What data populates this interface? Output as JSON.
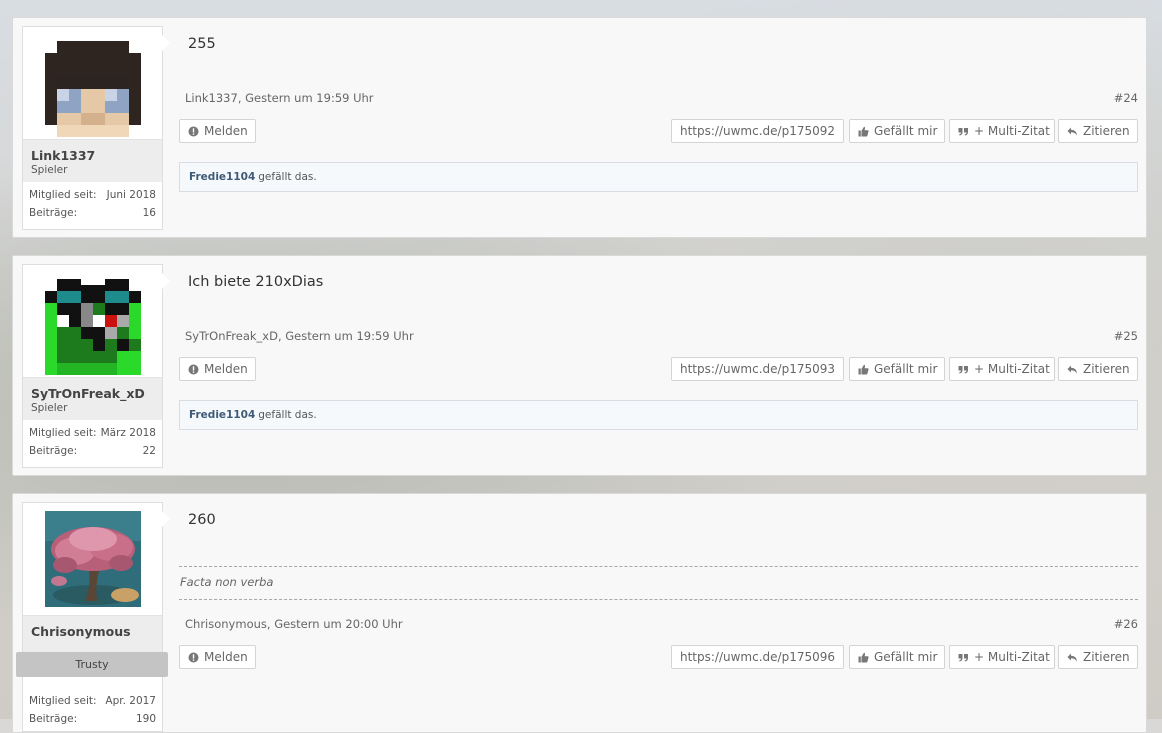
{
  "posts": [
    {
      "username": "Link1337",
      "rank": "Spieler",
      "member_since_label": "Mitglied seit:",
      "member_since": "Juni 2018",
      "posts_label": "Beiträge:",
      "post_count": "16",
      "message": "255",
      "author_time": "Link1337, Gestern um 19:59 Uhr",
      "post_number": "#24",
      "report_label": "Melden",
      "url": "https://uwmc.de/p175092",
      "like_label": "Gefällt mir",
      "multiquote_label": "+ Multi-Zitat",
      "quote_label": "Zitieren",
      "liker": "Fredie1104",
      "likes_text": "gefällt das."
    },
    {
      "username": "SyTrOnFreak_xD",
      "rank": "Spieler",
      "member_since_label": "Mitglied seit:",
      "member_since": "März 2018",
      "posts_label": "Beiträge:",
      "post_count": "22",
      "message": "Ich biete 210xDias",
      "author_time": "SyTrOnFreak_xD, Gestern um 19:59 Uhr",
      "post_number": "#25",
      "report_label": "Melden",
      "url": "https://uwmc.de/p175093",
      "like_label": "Gefällt mir",
      "multiquote_label": "+ Multi-Zitat",
      "quote_label": "Zitieren",
      "liker": "Fredie1104",
      "likes_text": "gefällt das."
    },
    {
      "username": "Chrisonymous",
      "rank_badge": "Trusty",
      "member_since_label": "Mitglied seit:",
      "member_since": "Apr. 2017",
      "posts_label": "Beiträge:",
      "post_count": "190",
      "message": "260",
      "signature": "Facta non verba",
      "author_time": "Chrisonymous, Gestern um 20:00 Uhr",
      "post_number": "#26",
      "report_label": "Melden",
      "url": "https://uwmc.de/p175096",
      "like_label": "Gefällt mir",
      "multiquote_label": "+ Multi-Zitat",
      "quote_label": "Zitieren"
    }
  ],
  "icons": {
    "report": "exclamation-circle-icon",
    "like": "thumbs-up-icon",
    "multiquote": "quote-icon",
    "quote": "reply-icon"
  },
  "colors": {
    "username_link": "#3e5a77",
    "panel_bg": "#f8f8f8",
    "rank_badge_bg": "#c4c4c4"
  }
}
